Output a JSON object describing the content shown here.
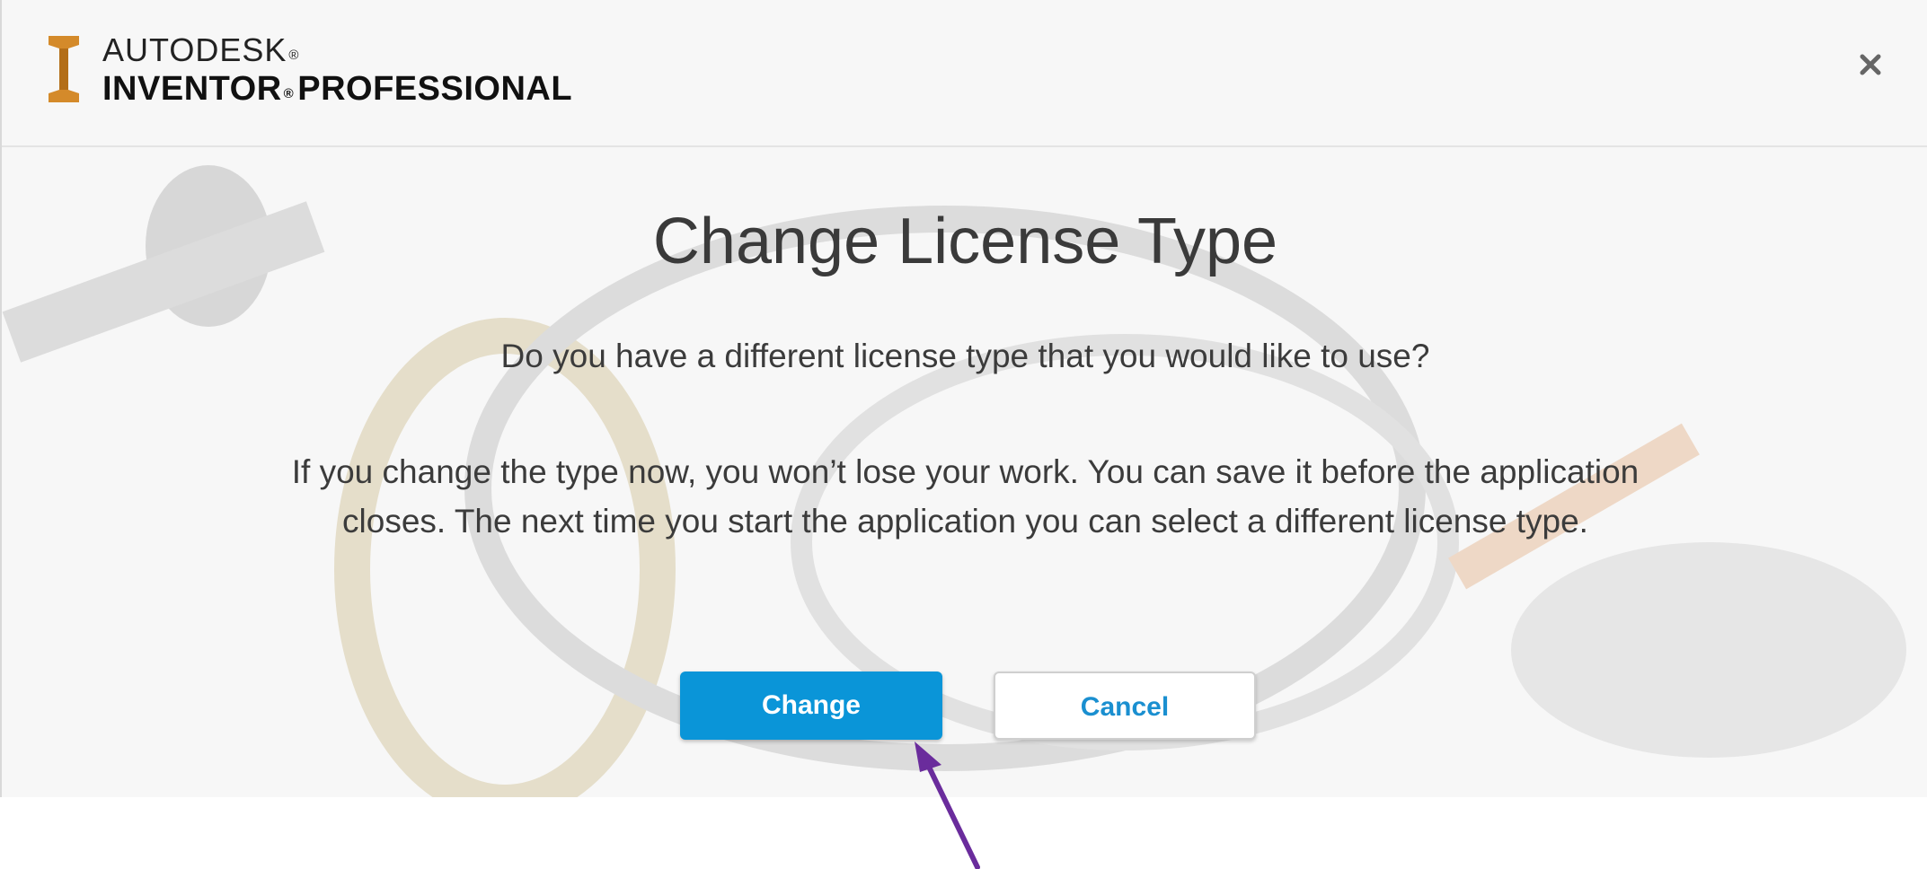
{
  "header": {
    "brand_line1": "AUTODESK",
    "brand_line2": "INVENTOR",
    "brand_line2_suffix": "PROFESSIONAL",
    "registered_mark": "®",
    "logo_icon": "inventor-logo-icon",
    "close_icon": "close-icon"
  },
  "main": {
    "title": "Change License Type",
    "question": "Do you have a different license type that you would like to use?",
    "body_line1": "If you change the type now, you won’t lose your work. You can save it before the application",
    "body_line2": "closes. The next time you start the application you can select a different license type."
  },
  "actions": {
    "change_label": "Change",
    "cancel_label": "Cancel"
  },
  "colors": {
    "accent": "#0a95d8",
    "logo_orange": "#d48a2a",
    "annotation_arrow": "#6a2c9c"
  },
  "annotation": {
    "arrow_icon": "arrow-pointer-icon"
  }
}
